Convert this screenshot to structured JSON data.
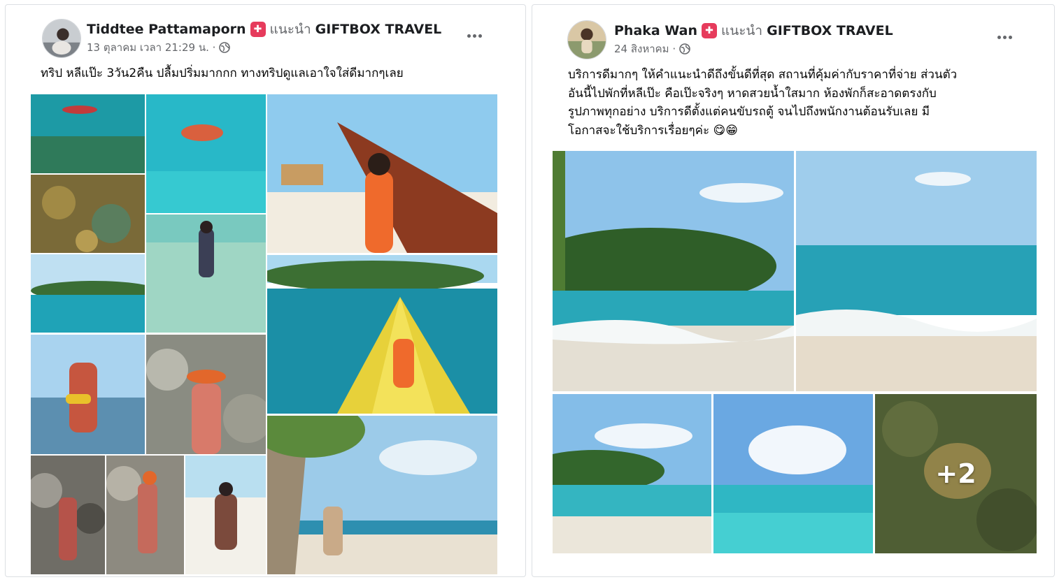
{
  "posts": [
    {
      "author": "Tiddtee Pattamaporn",
      "recommends_label": "แนะนำ",
      "page_name": "GIFTBOX TRAVEL",
      "timestamp": "13 ตุลาคม เวลา 21:29 น. ·",
      "text_lines": [
        "ทริป หลีแป๊ะ 3วัน2คืน ปลื้มปริ่มมากกก ทางทริปดูแลเอาใจใส่ดีมากๆเลย"
      ],
      "photo_count_visible": 12
    },
    {
      "author": "Phaka Wan",
      "recommends_label": "แนะนำ",
      "page_name": "GIFTBOX TRAVEL",
      "timestamp": "24 สิงหาคม ·",
      "text_lines": [
        "บริการดีมากๆ ให้คำแนะนำดีถึงขั้นดีที่สุด สถานที่คุ้มค่ากับราคาที่จ่าย ส่วนตัว",
        "อันนี้ไปพักที่หลีเป๊ะ คือเป๊ะจริงๆ หาดสวยน้ำใสมาก ห้องพักก็สะอาดตรงกับ",
        "รูปภาพทุกอย่าง บริการดีตั้งแต่คนขับรถตู้ จนไปถึงพนักงานต้อนรับเลย มี",
        "โอกาสจะใช้บริการเรื่อยๆค่ะ 😋😁"
      ],
      "photo_count_visible": 5,
      "more_photos_label": "+2"
    }
  ],
  "icons": {
    "badge": "recommend-badge-icon",
    "audience": "globe-icon",
    "menu": "more-options-icon"
  },
  "colors": {
    "badge": "#e63b5c",
    "secondary_text": "#65676b",
    "primary_text": "#050505",
    "card_border": "#dcdfe3"
  }
}
